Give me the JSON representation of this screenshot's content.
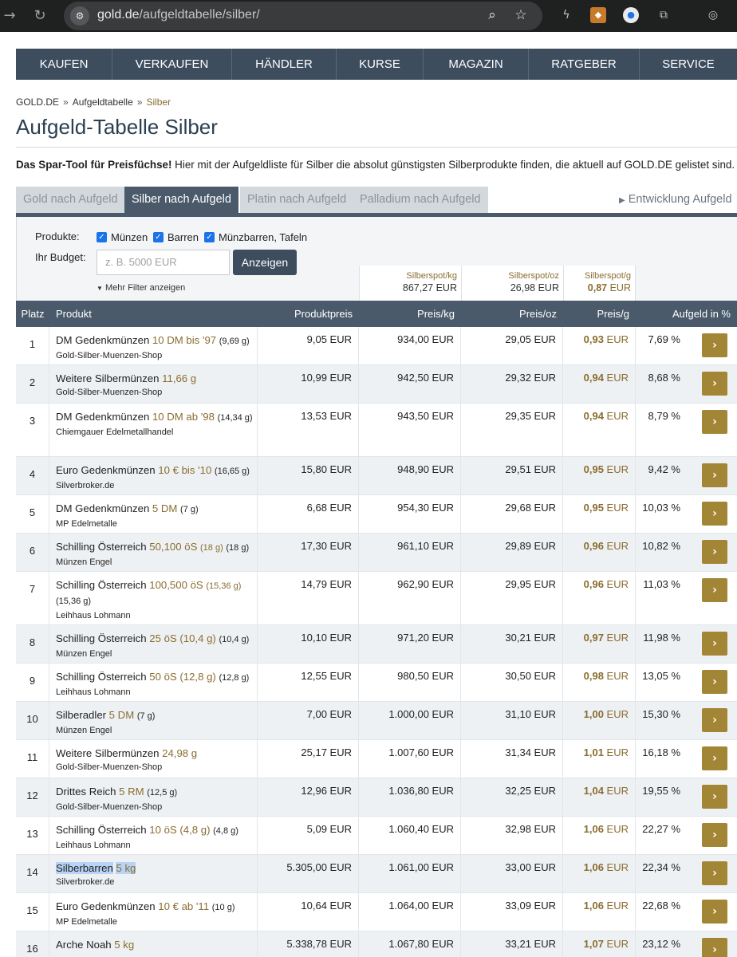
{
  "browser": {
    "url_host": "gold.de",
    "url_path": "/aufgeldtabelle/silber/",
    "icons": [
      "forward-icon",
      "reload-icon",
      "site-settings-icon",
      "zoom-icon",
      "bookmark-star-icon",
      "extension-icons",
      "puzzle-icon",
      "performance-icon"
    ]
  },
  "nav": [
    "KAUFEN",
    "VERKAUFEN",
    "HÄNDLER",
    "KURSE",
    "MAGAZIN",
    "RATGEBER",
    "SERVICE"
  ],
  "breadcrumb": {
    "home": "GOLD.DE",
    "level1": "Aufgeldtabelle",
    "current": "Silber",
    "sep": "»"
  },
  "title": "Aufgeld-Tabelle Silber",
  "intro": {
    "bold": "Das Spar-Tool für Preisfüchse!",
    "text": " Hier mit der Aufgeldliste für Silber die absolut günstigsten Silberprodukte finden, die aktuell auf GOLD.DE gelistet sind."
  },
  "tabs": [
    "Gold nach Aufgeld",
    "Silber nach Aufgeld",
    "Platin nach Aufgeld",
    "Palladium nach Aufgeld"
  ],
  "dev_link": "Entwicklung Aufgeld",
  "filter": {
    "products_label": "Produkte:",
    "opt1": "Münzen",
    "opt2": "Barren",
    "opt3": "Münzbarren, Tafeln",
    "budget_label": "Ihr Budget:",
    "budget_placeholder": "z. B. 5000 EUR",
    "show_button": "Anzeigen",
    "more_filter": "Mehr Filter anzeigen"
  },
  "spot": [
    {
      "label": "Silberspot/kg",
      "value": "867,27 EUR"
    },
    {
      "label": "Silberspot/oz",
      "value": "26,98 EUR"
    },
    {
      "label": "Silberspot/g",
      "value": "0,87",
      "unit": " EUR"
    }
  ],
  "headers": {
    "rank": "Platz",
    "product": "Produkt",
    "price": "Produktpreis",
    "kg": "Preis/kg",
    "oz": "Preis/oz",
    "g": "Preis/g",
    "premium": "Aufgeld in %"
  },
  "rows": [
    {
      "rank": "1",
      "name": "DM Gedenkmünzen",
      "size": "10 DM bis '97",
      "weight": "(9,69 g)",
      "dealer": "Gold-Silber-Muenzen-Shop",
      "price": "9,05 EUR",
      "kg": "934,00 EUR",
      "oz": "29,05 EUR",
      "g": "0,93",
      "g_unit": " EUR",
      "premium": "7,69 %"
    },
    {
      "rank": "2",
      "name": "Weitere Silbermünzen",
      "size": "11,66 g",
      "weight": "",
      "dealer": "Gold-Silber-Muenzen-Shop",
      "price": "10,99 EUR",
      "kg": "942,50 EUR",
      "oz": "29,32 EUR",
      "g": "0,94",
      "g_unit": " EUR",
      "premium": "8,68 %"
    },
    {
      "rank": "3",
      "name": "DM Gedenkmünzen",
      "size": "10 DM ab '98",
      "weight": "(14,34 g)",
      "dealer": "Chiemgauer Edelmetallhandel",
      "price": "13,53 EUR",
      "kg": "943,50 EUR",
      "oz": "29,35 EUR",
      "g": "0,94",
      "g_unit": " EUR",
      "premium": "8,79 %"
    },
    {
      "rank": "4",
      "name": "Euro Gedenkmünzen",
      "size": "10 € bis '10",
      "weight": "(16,65 g)",
      "dealer": "Silverbroker.de",
      "price": "15,80 EUR",
      "kg": "948,90 EUR",
      "oz": "29,51 EUR",
      "g": "0,95",
      "g_unit": " EUR",
      "premium": "9,42 %"
    },
    {
      "rank": "5",
      "name": "DM Gedenkmünzen",
      "size": "5 DM",
      "weight": "(7 g)",
      "dealer": "MP Edelmetalle",
      "price": "6,68 EUR",
      "kg": "954,30 EUR",
      "oz": "29,68 EUR",
      "g": "0,95",
      "g_unit": " EUR",
      "premium": "10,03 %"
    },
    {
      "rank": "6",
      "name": "Schilling Österreich",
      "size": "50,100 öS",
      "size2": "(18 g)",
      "weight": "(18 g)",
      "dealer": "Münzen Engel",
      "price": "17,30 EUR",
      "kg": "961,10 EUR",
      "oz": "29,89 EUR",
      "g": "0,96",
      "g_unit": " EUR",
      "premium": "10,82 %"
    },
    {
      "rank": "7",
      "name": "Schilling Österreich",
      "size": "100,500 öS",
      "size2": "(15,36 g)",
      "weight": "(15,36 g)",
      "dealer": "Leihhaus Lohmann",
      "price": "14,79 EUR",
      "kg": "962,90 EUR",
      "oz": "29,95 EUR",
      "g": "0,96",
      "g_unit": " EUR",
      "premium": "11,03 %"
    },
    {
      "rank": "8",
      "name": "Schilling Österreich",
      "size": "25 öS (10,4 g)",
      "weight": "(10,4 g)",
      "dealer": "Münzen Engel",
      "price": "10,10 EUR",
      "kg": "971,20 EUR",
      "oz": "30,21 EUR",
      "g": "0,97",
      "g_unit": " EUR",
      "premium": "11,98 %"
    },
    {
      "rank": "9",
      "name": "Schilling Österreich",
      "size": "50 öS (12,8 g)",
      "weight": "(12,8 g)",
      "dealer": "Leihhaus Lohmann",
      "price": "12,55 EUR",
      "kg": "980,50 EUR",
      "oz": "30,50 EUR",
      "g": "0,98",
      "g_unit": " EUR",
      "premium": "13,05 %"
    },
    {
      "rank": "10",
      "name": "Silberadler",
      "size": "5 DM",
      "weight": "(7 g)",
      "dealer": "Münzen Engel",
      "price": "7,00 EUR",
      "kg": "1.000,00 EUR",
      "oz": "31,10 EUR",
      "g": "1,00",
      "g_unit": " EUR",
      "premium": "15,30 %"
    },
    {
      "rank": "11",
      "name": "Weitere Silbermünzen",
      "size": "24,98 g",
      "weight": "",
      "dealer": "Gold-Silber-Muenzen-Shop",
      "price": "25,17 EUR",
      "kg": "1.007,60 EUR",
      "oz": "31,34 EUR",
      "g": "1,01",
      "g_unit": " EUR",
      "premium": "16,18 %"
    },
    {
      "rank": "12",
      "name": "Drittes Reich",
      "size": "5 RM",
      "weight": "(12,5 g)",
      "dealer": "Gold-Silber-Muenzen-Shop",
      "price": "12,96 EUR",
      "kg": "1.036,80 EUR",
      "oz": "32,25 EUR",
      "g": "1,04",
      "g_unit": " EUR",
      "premium": "19,55 %"
    },
    {
      "rank": "13",
      "name": "Schilling Österreich",
      "size": "10 öS (4,8 g)",
      "weight": "(4,8 g)",
      "dealer": "Leihhaus Lohmann",
      "price": "5,09 EUR",
      "kg": "1.060,40 EUR",
      "oz": "32,98 EUR",
      "g": "1,06",
      "g_unit": " EUR",
      "premium": "22,27 %"
    },
    {
      "rank": "14",
      "name": "Silberbarren",
      "size": "5 kg",
      "weight": "",
      "dealer": "Silverbroker.de",
      "price": "5.305,00 EUR",
      "kg": "1.061,00 EUR",
      "oz": "33,00 EUR",
      "g": "1,06",
      "g_unit": " EUR",
      "premium": "22,34 %",
      "highlight": true
    },
    {
      "rank": "15",
      "name": "Euro Gedenkmünzen",
      "size": "10 € ab '11",
      "weight": "(10 g)",
      "dealer": "MP Edelmetalle",
      "price": "10,64 EUR",
      "kg": "1.064,00 EUR",
      "oz": "33,09 EUR",
      "g": "1,06",
      "g_unit": " EUR",
      "premium": "22,68 %"
    },
    {
      "rank": "16",
      "name": "Arche Noah",
      "size": "5 kg",
      "weight": "",
      "dealer": "",
      "price": "5.338,78 EUR",
      "kg": "1.067,80 EUR",
      "oz": "33,21 EUR",
      "g": "1,07",
      "g_unit": " EUR",
      "premium": "23,12 %"
    }
  ],
  "go_glyph": "›"
}
